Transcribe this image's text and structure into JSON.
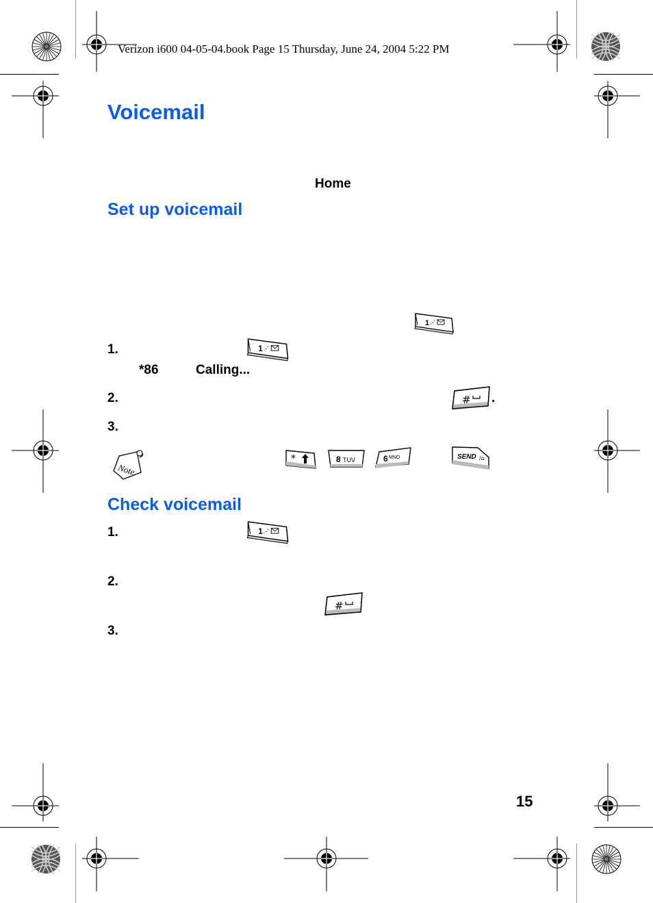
{
  "header": {
    "running_head": "Verizon i600 04-05-04.book  Page 15  Thursday, June 24, 2004  5:22 PM"
  },
  "page": {
    "title": "Voicemail",
    "page_number": "15",
    "home_label": "Home"
  },
  "sections": [
    {
      "heading": "Set up voicemail",
      "steps": [
        {
          "number": "1.",
          "inline_text": [
            "*86",
            "Calling..."
          ]
        },
        {
          "number": "2.",
          "trailing": "."
        },
        {
          "number": "3."
        }
      ]
    },
    {
      "heading": "Check voicemail",
      "steps": [
        {
          "number": "1."
        },
        {
          "number": "2."
        },
        {
          "number": "3."
        }
      ]
    }
  ],
  "keys": {
    "one_voicemail": {
      "label": "1",
      "icon": "voicemail-envelope-icon"
    },
    "pound_space": {
      "label": "#",
      "icon": "space-icon"
    },
    "star_shift": {
      "label": "*",
      "icon": "shift-arrow-icon"
    },
    "eight": {
      "label": "8",
      "letters": "TUV"
    },
    "six": {
      "label": "6",
      "letters": "MNO"
    },
    "send": {
      "label": "SEND",
      "icon": "speakerphone-icon"
    }
  },
  "note_icon": {
    "label": "Note"
  },
  "colors": {
    "heading_blue": "#0a5de6",
    "text": "#000000"
  }
}
